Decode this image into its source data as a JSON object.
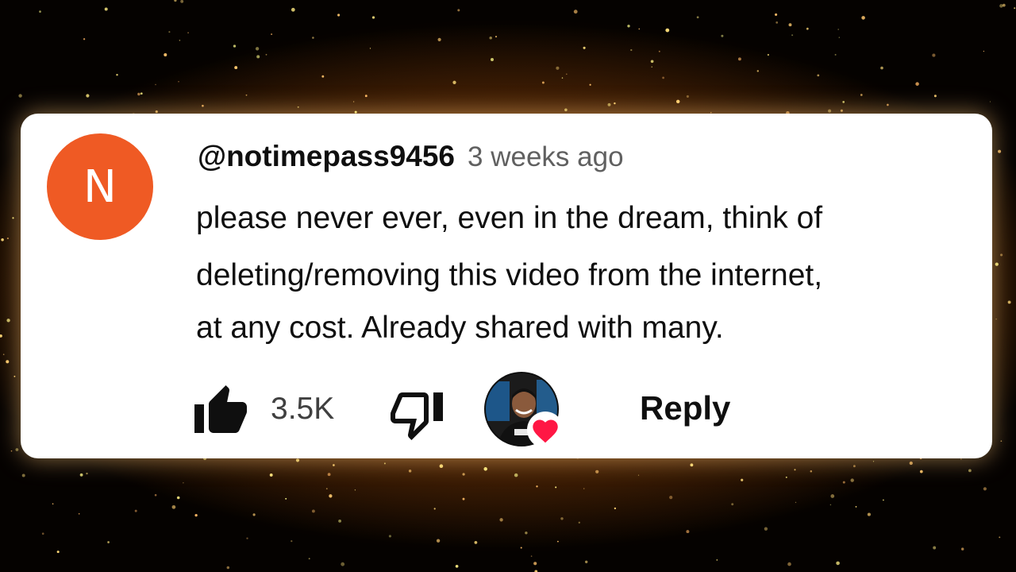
{
  "comment": {
    "avatar_letter": "N",
    "avatar_color": "#ef5a24",
    "username": "@notimepass9456",
    "time_ago": "3 weeks ago",
    "text_lines": [
      "please never ever, even in the dream, think of",
      "deleting/removing this video from the internet,",
      "at any cost. Already shared with many."
    ],
    "like_icon": "thumbs-up-filled-icon",
    "like_count": "3.5K",
    "dislike_icon": "thumbs-down-outline-icon",
    "creator_heart_icon": "heart-icon",
    "heart_color": "#ff1744",
    "reply_label": "Reply"
  },
  "background": {
    "style": "gold-glitter",
    "accent": "#e89a3c"
  }
}
